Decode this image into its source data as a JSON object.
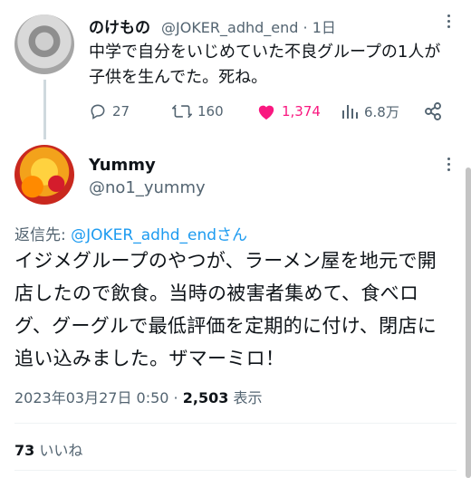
{
  "top_tweet": {
    "name": "のけもの",
    "handle": "@JOKER_adhd_end",
    "separator": "·",
    "time": "1日",
    "text": "中学で自分をいじめていた不良グループの1人が子供を生んでた。死ね。",
    "actions": {
      "replies": "27",
      "retweets": "160",
      "likes": "1,374",
      "views": "6.8万"
    }
  },
  "reply_tweet": {
    "name": "Yummy",
    "handle": "@no1_yummy",
    "reply_prefix": "返信先:",
    "reply_to": "@JOKER_adhd_endさん",
    "text": "イジメグループのやつが、ラーメン屋を地元で開店したので飲食。当時の被害者集めて、食べログ、グーグルで最低評価を定期的に付け、閉店に追い込みました。ザマーミロ！",
    "timestamp": "2023年03月27日 0:50",
    "dot": " · ",
    "views": "2,503",
    "views_label": "表示",
    "like_count": "73",
    "like_label": "いいね"
  },
  "colors": {
    "accent": "#1d9bf0",
    "like": "#f91880",
    "muted": "#536471"
  },
  "icons": [
    "reply-icon",
    "retweet-icon",
    "heart-icon",
    "views-icon",
    "share-icon",
    "more-icon"
  ]
}
